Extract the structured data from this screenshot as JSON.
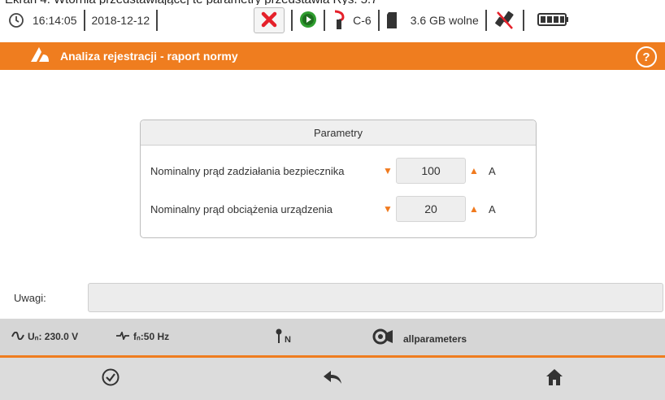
{
  "caption": "Ekran 4. Wtórnia przedstawiającej te parametry przedstawia Rys. 5.7",
  "status": {
    "time": "16:14:05",
    "date": "2018-12-12",
    "clamp_type": "C-6",
    "storage_free": "3.6 GB wolne"
  },
  "titlebar": {
    "title": "Analiza rejestracji - raport normy",
    "help": "?"
  },
  "parameters": {
    "header": "Parametry",
    "rows": [
      {
        "label": "Nominalny prąd zadziałania bezpiecznika",
        "value": "100",
        "unit": "A"
      },
      {
        "label": "Nominalny prąd obciążenia urządzenia",
        "value": "20",
        "unit": "A"
      }
    ]
  },
  "remarks": {
    "label": "Uwagi:",
    "value": ""
  },
  "infobar": {
    "voltage": "Uₙ: 230.0 V",
    "frequency": "fₙ:50 Hz",
    "neutral": "N",
    "config": "allparameters"
  },
  "colors": {
    "accent": "#ef7d1f",
    "close_red": "#e5202a",
    "start_green": "#2f9e2f"
  },
  "icons": [
    "clock-icon",
    "close-icon",
    "play-icon",
    "clamp-icon",
    "sd-card-icon",
    "usb-disconnected-icon",
    "battery-icon",
    "logo-icon",
    "help-icon",
    "sine-wave-icon",
    "frequency-icon",
    "probe-icon",
    "config-icon",
    "confirm-icon",
    "back-icon",
    "home-icon"
  ]
}
